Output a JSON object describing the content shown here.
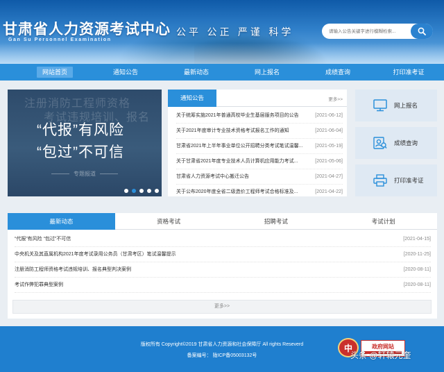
{
  "header": {
    "title": "甘肃省人力资源考试中心",
    "subtitle": "Gan Su Personnel Examination",
    "motto": "公平 公正 严谨 科学",
    "search_placeholder": "请输入公告关键字进行模糊检索..."
  },
  "nav": {
    "items": [
      {
        "label": "网站首页"
      },
      {
        "label": "通知公告"
      },
      {
        "label": "最新动态"
      },
      {
        "label": "网上报名"
      },
      {
        "label": "成绩查询"
      },
      {
        "label": "打印准考证"
      }
    ]
  },
  "banner": {
    "ghost_line1": "注册消防工程师资格",
    "ghost_line2": "考试违规培训、报名",
    "line1": "“代报”有风险",
    "line2": "“包过”不可信",
    "tag": "专题报道",
    "dots_count": 5,
    "active_dot": 1
  },
  "notice": {
    "tab": "通知公告",
    "more": "更多>>",
    "items": [
      {
        "title": "关于统筹实施2021年普通高校毕业生基层服务项目的公告",
        "date": "[2021-06-12]"
      },
      {
        "title": "关于2021年度审计专业技术资格考试报名工作的通知",
        "date": "[2021-06-04]"
      },
      {
        "title": "甘肃省2021年上半年事业单位公开招聘分类考试笔试温馨...",
        "date": "[2021-05-19]"
      },
      {
        "title": "关于甘肃省2021年度专业技术人员计算机应用能力考试...",
        "date": "[2021-05-06]"
      },
      {
        "title": "甘肃省人力资源考试中心搬迁公告",
        "date": "[2021-04-27]"
      },
      {
        "title": "关于公布2020年度全省二级造价工程师考试合格标准及...",
        "date": "[2021-04-22]"
      }
    ]
  },
  "quick_links": [
    {
      "label": "网上报名",
      "icon": "monitor-icon"
    },
    {
      "label": "成绩查询",
      "icon": "search-user-icon"
    },
    {
      "label": "打印准考证",
      "icon": "printer-icon"
    }
  ],
  "tabs": [
    {
      "label": "最新动态"
    },
    {
      "label": "资格考试"
    },
    {
      "label": "招聘考试"
    },
    {
      "label": "考试计划"
    }
  ],
  "news": [
    {
      "title": "“代报”有风险 “包过”不可信",
      "date": "[2021-04-15]"
    },
    {
      "title": "中央机关及其直属机构2021年度考试录用公务员（甘肃考区）笔试温馨提示",
      "date": "[2020-11-25]"
    },
    {
      "title": "注册消防工程师资格考试违规培训、报名典型判决案例",
      "date": "[2020-08-11]"
    },
    {
      "title": "考试作弊犯罪典型案例",
      "date": "[2020-08-11]"
    }
  ],
  "news_more": "更多>>",
  "footer": {
    "copyright": "版权所有 Copyright©2019 甘肃省人力资源和社会保障厅 All rights Reseverd",
    "icp": "备案编号： 陇ICP备05003132号",
    "gov_badge_char": "中",
    "gov_label": "政府网站",
    "watermark": "头条 @轩辕元奎"
  },
  "colors": {
    "primary": "#2a8fda",
    "header_dark": "#0f5aa8",
    "footer": "#1f7fcf",
    "quick_bg": "#dfe9f3"
  }
}
